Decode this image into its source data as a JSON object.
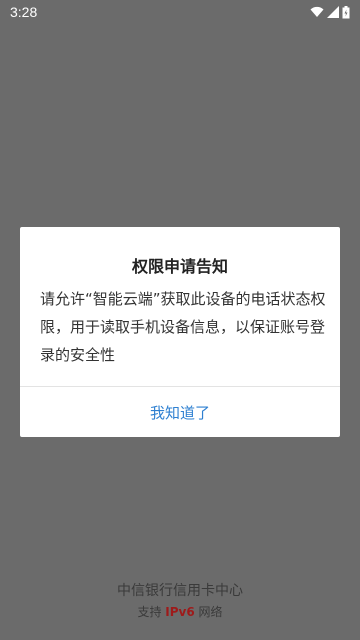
{
  "status_bar": {
    "time": "3:28",
    "icons": [
      "wifi-icon",
      "signal-icon",
      "battery-icon"
    ]
  },
  "dialog": {
    "title": "权限申请告知",
    "message": "请允许“智能云端”获取此设备的电话状态权限，用于读取手机设备信息，以保证账号登录的安全性",
    "confirm_label": "我知道了"
  },
  "footer": {
    "title": "中信银行信用卡中心",
    "support_prefix": "支持",
    "ipv6_label": "IPv6",
    "support_suffix": "网络"
  },
  "colors": {
    "overlay": "#6b6b6b",
    "dialog_background": "#ffffff",
    "accent": "#2f80d1",
    "ipv6": "#9e1a1a"
  }
}
